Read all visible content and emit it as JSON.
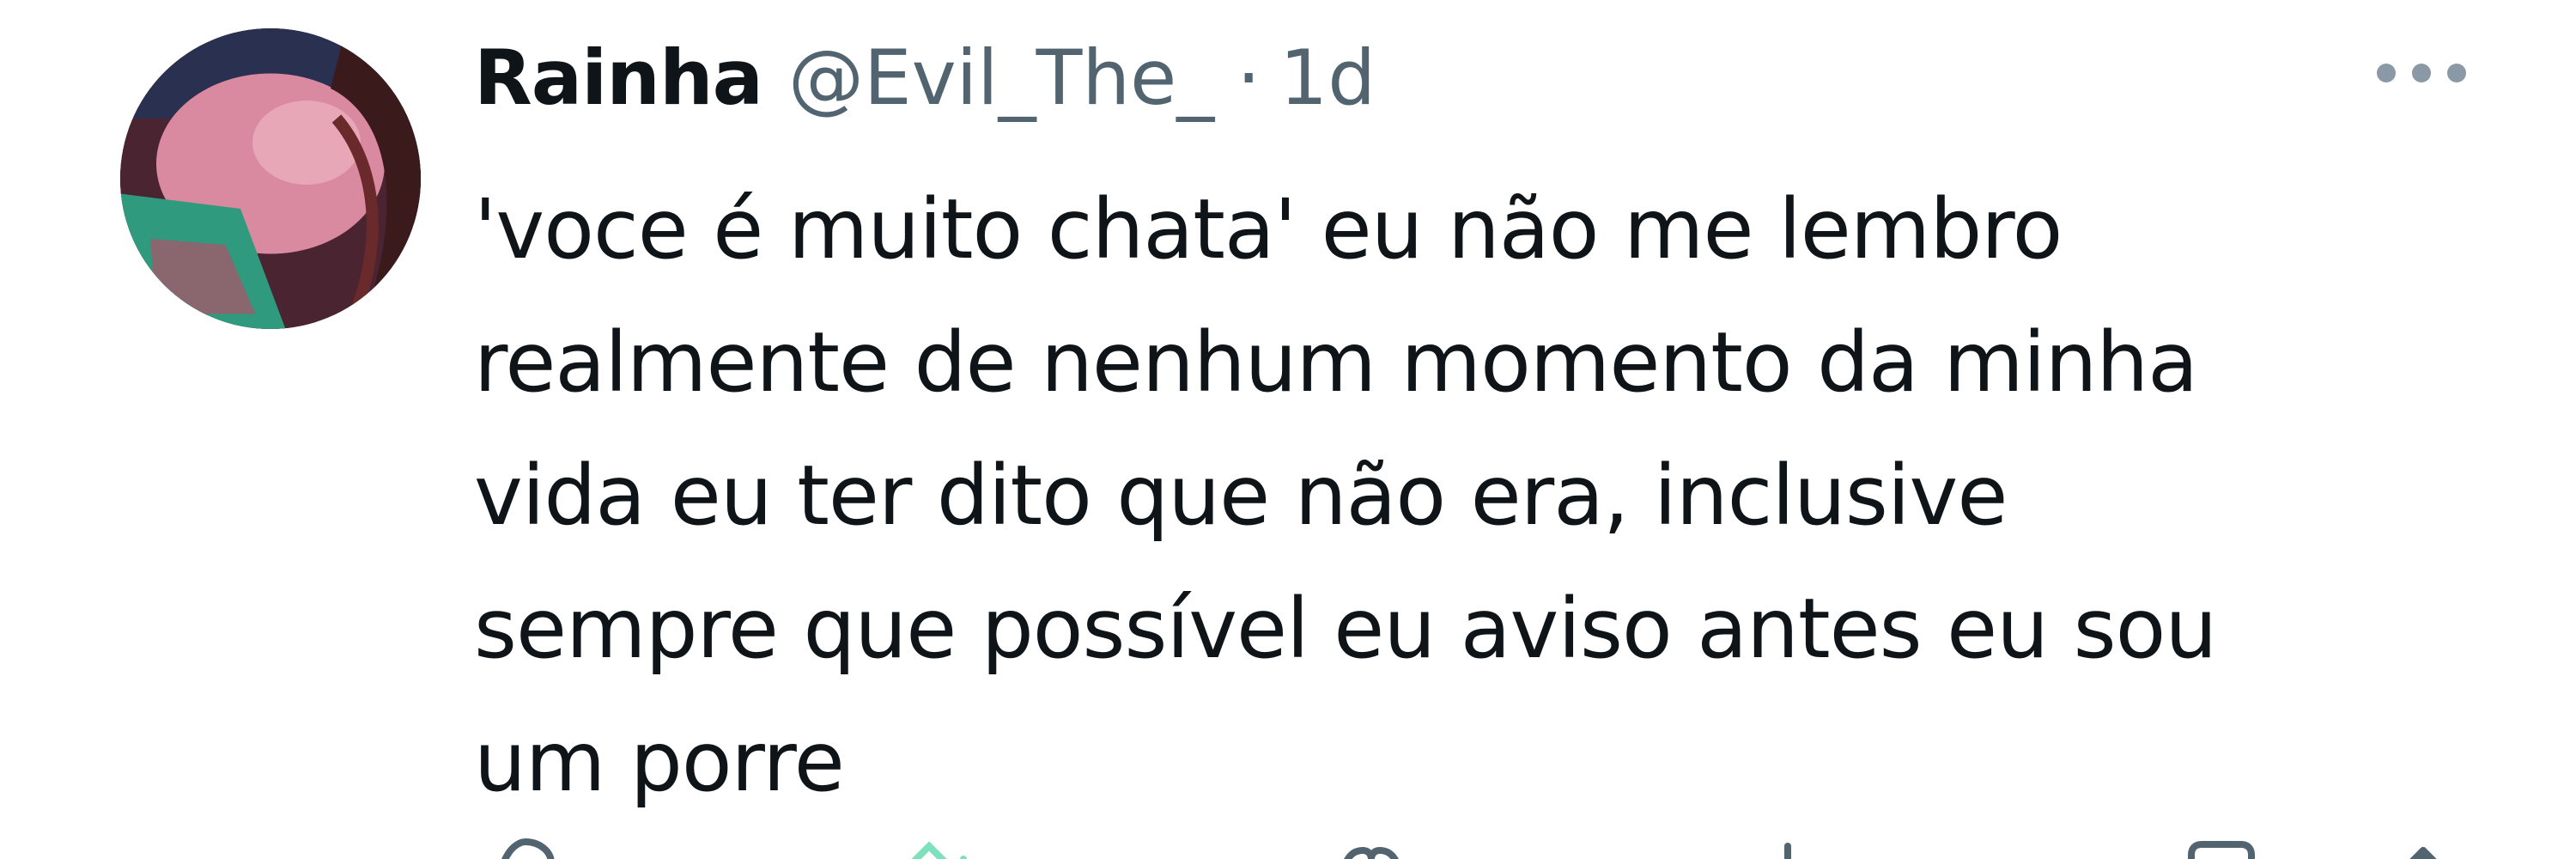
{
  "tweet": {
    "display_name": "Rainha",
    "handle": "@Evil_The_",
    "separator": "·",
    "time": "1d",
    "text_lines": [
      "'voce é muito chata' eu não me lembro",
      "realmente de nenhum momento da minha",
      "vida eu ter dito que não era, inclusive",
      "sempre que possível eu aviso antes eu sou",
      "um porre"
    ]
  },
  "icons": {
    "more": "more-horizontal-icon",
    "reply": "reply-icon",
    "retweet": "retweet-icon",
    "like": "like-icon",
    "views": "views-icon",
    "bookmark": "bookmark-icon",
    "share": "share-icon"
  },
  "colors": {
    "text": "#0f1419",
    "secondary": "#536471",
    "retweet_active": "#00ba7c"
  }
}
